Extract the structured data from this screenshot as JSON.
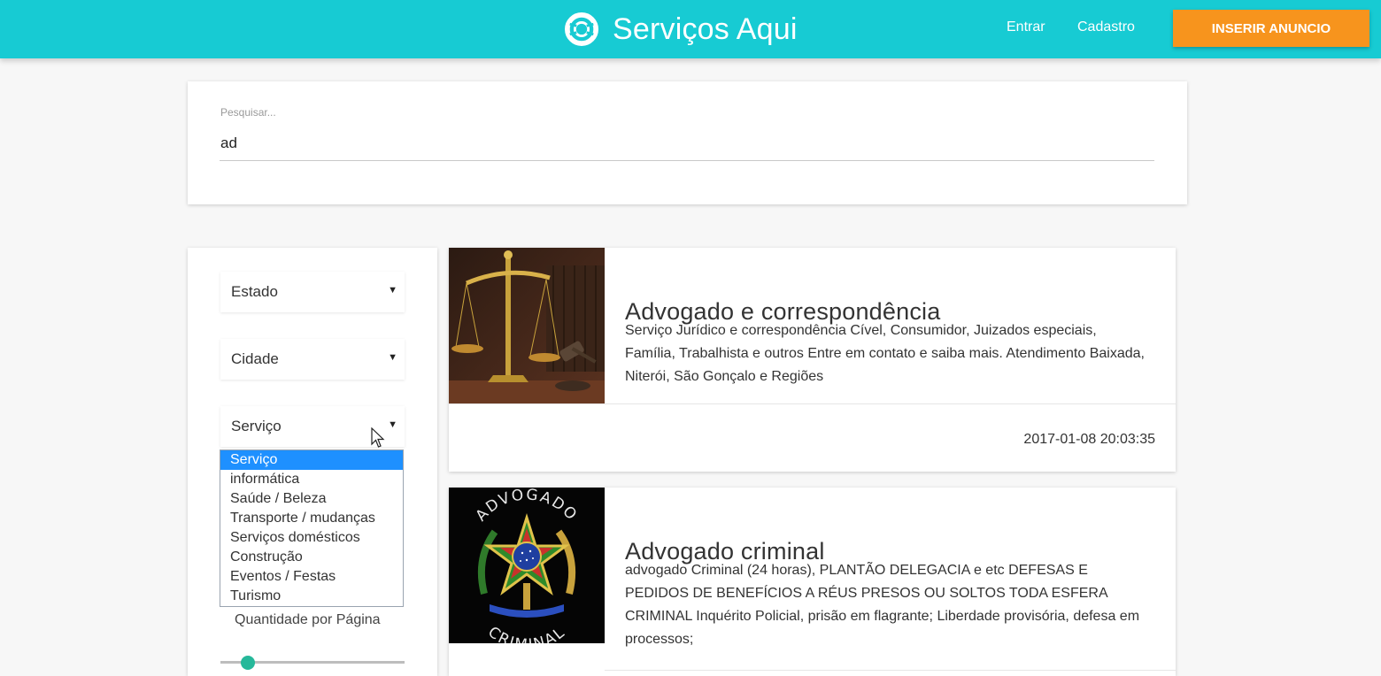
{
  "header": {
    "title": "Serviços Aqui",
    "icon": "lifebuoy-icon",
    "nav": {
      "login": "Entrar",
      "signup": "Cadastro"
    },
    "insert_button": "INSERIR ANUNCIO",
    "colors": {
      "bar": "#17cbd3",
      "accent": "#f7941d"
    }
  },
  "search": {
    "label": "Pesquisar...",
    "value": "ad"
  },
  "filters": {
    "estado": "Estado",
    "cidade": "Cidade",
    "servico": "Serviço",
    "servico_options": [
      "Serviço",
      "informática",
      "Saúde / Beleza",
      "Transporte / mudanças",
      "Serviços domésticos",
      "Construção",
      "Eventos / Festas",
      "Turismo"
    ],
    "selected_option_index": 0,
    "quantity_label": "Quantidade por Página",
    "quantity_slider_fraction": 0.15
  },
  "listings": [
    {
      "title": "Advogado e correspondência",
      "description": "Serviço Jurídico e correspondência Cível, Consumidor, Juizados especiais, Família, Trabalhista e outros Entre em contato e saiba mais. Atendimento Baixada, Niterói, São Gonçalo e Regiões",
      "date": "2017-01-08 20:03:35",
      "image": "scales-of-justice-image"
    },
    {
      "title": "Advogado criminal",
      "description": "advogado Criminal (24 horas), PLANTÃO DELEGACIA e etc DEFESAS E PEDIDOS DE BENEFÍCIOS A RÉUS PRESOS OU SOLTOS TODA ESFERA CRIMINAL Inquérito Policial, prisão em flagrante; Liberdade provisória, defesa em processos;",
      "image": "coat-of-arms-image",
      "image_top_text": "ADVOGADO",
      "image_bottom_text": "CRIMINAL"
    }
  ]
}
